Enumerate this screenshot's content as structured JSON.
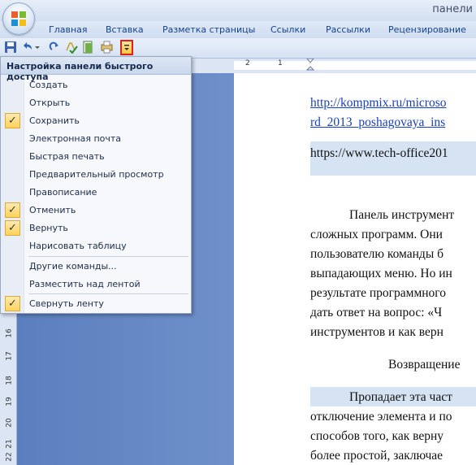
{
  "title": "панели",
  "tabs": [
    {
      "label": "Главная"
    },
    {
      "label": "Вставка"
    },
    {
      "label": "Разметка страницы"
    },
    {
      "label": "Ссылки"
    },
    {
      "label": "Рассылки"
    },
    {
      "label": "Рецензирование"
    }
  ],
  "menu": {
    "header": "Настройка панели быстрого доступа",
    "items": [
      {
        "label": "Создать",
        "checked": false
      },
      {
        "label": "Открыть",
        "checked": false
      },
      {
        "label": "Сохранить",
        "checked": true
      },
      {
        "label": "Электронная почта",
        "checked": false
      },
      {
        "label": "Быстрая печать",
        "checked": false
      },
      {
        "label": "Предварительный просмотр",
        "checked": false
      },
      {
        "label": "Правописание",
        "checked": false
      },
      {
        "label": "Отменить",
        "checked": true
      },
      {
        "label": "Вернуть",
        "checked": true
      },
      {
        "label": "Нарисовать таблицу",
        "checked": false
      },
      {
        "label": "Другие команды...",
        "checked": false
      },
      {
        "label": "Разместить над лентой",
        "checked": false
      },
      {
        "label": "Свернуть ленту",
        "checked": true
      }
    ],
    "check_glyph": "✓"
  },
  "ruler": {
    "h_labels": [
      "2",
      "1"
    ],
    "v_labels": [
      "16",
      "17",
      "18",
      "19",
      "20",
      "21",
      "22"
    ]
  },
  "document": {
    "lines": [
      "http://kompmix.ru/microso",
      "rd_2013_poshagovaya_ins",
      "https://www.tech-office201",
      "Панель инструмент",
      "сложных программ. Они",
      "пользователю команды б",
      "выпадающих меню. Но ин",
      "результате программного",
      "дать ответ на вопрос: «Ч",
      "инструментов и как верн",
      "Возвращение",
      "Пропадает эта част",
      "отключение элемента и по",
      "способов того, как верну",
      "более простой, заключае"
    ]
  },
  "colors": {
    "accent": "#15428b",
    "check_bg": "#ffd35a",
    "customize_border": "#e0201a",
    "link": "#1a3fbf"
  }
}
